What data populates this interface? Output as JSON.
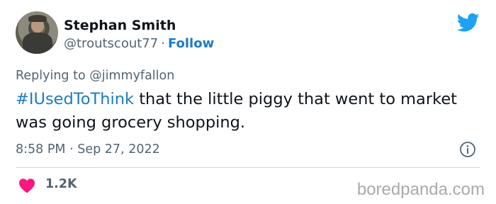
{
  "author": {
    "name": "Stephan Smith",
    "handle": "@troutscout77",
    "separator": "·",
    "follow_label": "Follow"
  },
  "reply": {
    "prefix": "Replying to",
    "target": "@jimmyfallon"
  },
  "tweet": {
    "hashtag": "#IUsedToThink",
    "text": " that the little piggy that went to market was going grocery shopping."
  },
  "meta": {
    "time": "8:58 PM",
    "separator": "·",
    "date": "Sep 27, 2022"
  },
  "engagement": {
    "likes": "1.2K"
  },
  "watermark": "boredpanda.com",
  "icons": {
    "logo": "twitter-bird-icon",
    "info": "info-icon",
    "like": "heart-icon"
  },
  "colors": {
    "accent": "#1d7bc3",
    "bird": "#1da1f2",
    "heart": "#f91880",
    "muted": "#536471"
  }
}
